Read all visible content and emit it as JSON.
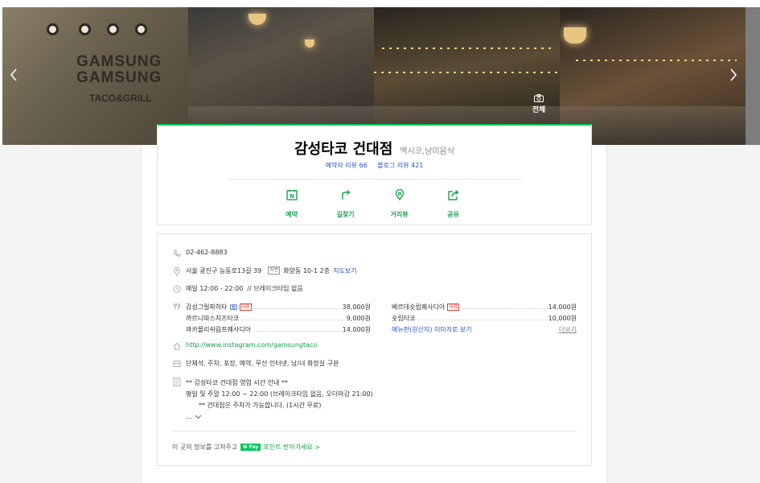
{
  "gallery": {
    "sign_line1": "GAMSUNG",
    "sign_line2": "GAMSUNG",
    "sign_sub": "TACO&GRILL",
    "all_photos_label": "전체",
    "prev_icon": "chevron-left-icon",
    "next_icon": "chevron-right-icon"
  },
  "place": {
    "name": "감성타코 건대점",
    "category": "멕시코,남미음식",
    "visitor_reviews": "예약자 리뷰 66",
    "blog_reviews": "블로그 리뷰 421"
  },
  "actions": [
    {
      "label": "예약",
      "icon": "calendar-icon"
    },
    {
      "label": "길찾기",
      "icon": "directions-icon"
    },
    {
      "label": "거리뷰",
      "icon": "street-view-icon"
    },
    {
      "label": "공유",
      "icon": "share-icon"
    }
  ],
  "info": {
    "phone": "02-462-8883",
    "address": "서울 광진구 능동로13길 39",
    "address_tag": "지번",
    "address_old": "화양동 10-1 2층",
    "map_link": "지도보기",
    "hours": "매일 12:00 - 22:00",
    "hours_note": "// 브레이크타임 없음",
    "menu": [
      {
        "name": "감성그릴파히타",
        "price": "38,000원"
      },
      {
        "name": "베르데숏립퀘사디아",
        "price": "14,000원"
      },
      {
        "name": "까르니따스치즈타코",
        "price": "9,000원"
      },
      {
        "name": "숏립타코",
        "price": "10,000원"
      },
      {
        "name": "꽈카몰리쉬림프퀘사디아",
        "price": "14,000원"
      }
    ],
    "menu_badge": "대표",
    "menu_image_link": "메뉴판(원산지) 이미지로 보기",
    "menu_more": "더보기",
    "homepage": "http://www.instagram.com/gamsungtaco",
    "amenities": "단체석, 주차, 포장, 예약, 무선 인터넷, 남/녀 화장실 구분",
    "notice_line1": "** 감성타코 건대점 영업 시간 안내 **",
    "notice_line2": "평일 및 주말 12:00 ~ 22:00 (브레이크타임 없음, 오더마감 21:00)",
    "notice_line3": "** 건대점은 주차가 가능합니다. (1시간 무료)",
    "notice_more": "...",
    "footer_text": "이 곳의 정보를 고쳐주고",
    "npay_label": "N Pay",
    "footer_link": "포인트 받아가세요 >"
  },
  "colors": {
    "accent_green": "#03c75a",
    "link_blue": "#2455c3",
    "badge_red": "#e0413a"
  }
}
